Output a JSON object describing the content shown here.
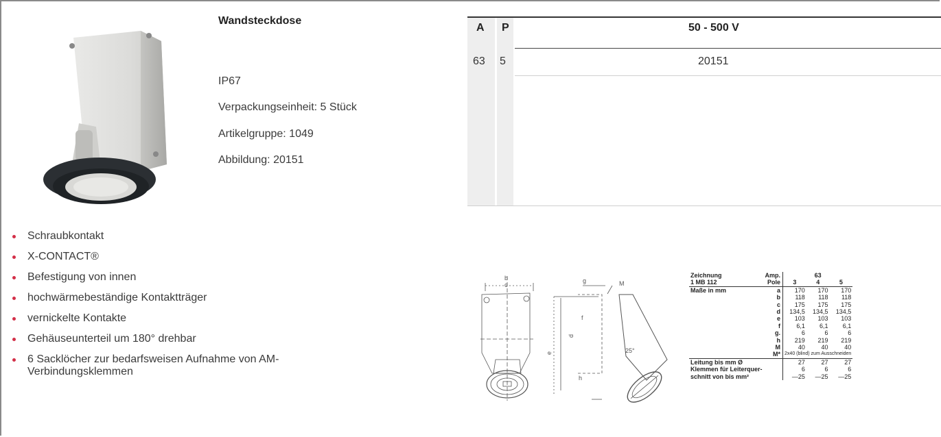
{
  "product": {
    "title": "Wandsteckdose",
    "protection": "IP67",
    "packaging": "Verpackungseinheit: 5 Stück",
    "article_group": "Artikelgruppe: 1049",
    "figure": "Abbildung: 20151"
  },
  "features": [
    "Schraubkontakt",
    "X-CONTACT®",
    "Befestigung von innen",
    "hochwärmebeständige Kontaktträger",
    "vernickelte Kontakte",
    "Gehäuseunterteil um 180° drehbar",
    "6 Sacklöcher zur bedarfsweisen Aufnahme von AM-Verbindungsklemmen"
  ],
  "spec_table": {
    "col_a": "A",
    "col_p": "P",
    "voltage": "50 - 500 V",
    "row": {
      "a": "63",
      "p": "5",
      "article": "20151"
    }
  },
  "dimensions": {
    "header": {
      "drawing": "Zeichnung",
      "drawing_no": "1 MB 112",
      "amp": "Amp.",
      "amp_value": "63",
      "pole": "Pole",
      "poles": [
        "3",
        "4",
        "5"
      ]
    },
    "measure_label": "Maße in mm",
    "rows": [
      {
        "key": "a",
        "values": [
          "170",
          "170",
          "170"
        ]
      },
      {
        "key": "b",
        "values": [
          "118",
          "118",
          "118"
        ]
      },
      {
        "key": "c",
        "values": [
          "175",
          "175",
          "175"
        ]
      },
      {
        "key": "d",
        "values": [
          "134,5",
          "134,5",
          "134,5"
        ]
      },
      {
        "key": "e",
        "values": [
          "103",
          "103",
          "103"
        ]
      },
      {
        "key": "f",
        "values": [
          "6,1",
          "6,1",
          "6,1"
        ]
      },
      {
        "key": "g.",
        "values": [
          "6",
          "6",
          "6"
        ]
      },
      {
        "key": "h",
        "values": [
          "219",
          "219",
          "219"
        ]
      },
      {
        "key": "M",
        "values": [
          "40",
          "40",
          "40"
        ]
      }
    ],
    "m_star": {
      "key": "M*",
      "note": "2x40 (blind) zum Ausschneiden"
    },
    "cable": {
      "label": "Leitung bis mm Ø",
      "values": [
        "27",
        "27",
        "27"
      ]
    },
    "terminals": {
      "label1": "Klemmen für Leiterquer-",
      "label2": "schnitt von bis mm²",
      "values1": [
        "6",
        "6",
        "6"
      ],
      "values2": [
        "—25",
        "—25",
        "—25"
      ]
    }
  },
  "drawing_labels": {
    "b": "b",
    "c": "c",
    "g": "g",
    "M": "M",
    "d": "d",
    "e": "e",
    "f": "f",
    "angle": "25°",
    "h": "h"
  },
  "colors": {
    "bullet": "#d32f48",
    "shade": "#eeeeee"
  }
}
